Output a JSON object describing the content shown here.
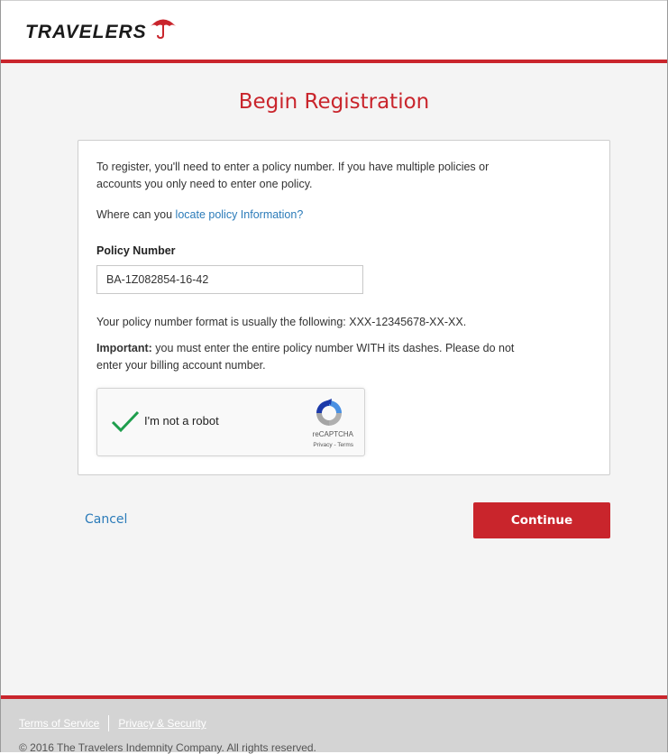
{
  "brand": {
    "logo_text": "TRAVELERS"
  },
  "page": {
    "title": "Begin Registration"
  },
  "intro": {
    "line1": "To register, you'll need to enter a policy number. If you have multiple policies or",
    "line2": "accounts you only need to enter one policy.",
    "locate_prefix": "Where can you ",
    "locate_link": "locate policy Information?"
  },
  "form": {
    "policy_label": "Policy Number",
    "policy_value": "BA-1Z082854-16-42",
    "format_hint": "Your policy number format is usually the following: XXX-12345678-XX-XX.",
    "important_label": "Important:",
    "important_line1": " you must enter the entire policy number WITH its dashes. Please do not",
    "important_line2": "enter your billing account number."
  },
  "captcha": {
    "label": "I'm not a robot",
    "brand": "reCAPTCHA",
    "links": "Privacy - Terms",
    "checked": true
  },
  "actions": {
    "cancel_label": "Cancel",
    "continue_label": "Continue"
  },
  "footer": {
    "terms_label": "Terms of Service",
    "privacy_label": "Privacy & Security",
    "copyright": "© 2016 The Travelers Indemnity Company. All rights reserved."
  },
  "colors": {
    "brand_red": "#c9252c",
    "link_blue": "#2b7bb9",
    "check_green": "#1e9e4d"
  }
}
